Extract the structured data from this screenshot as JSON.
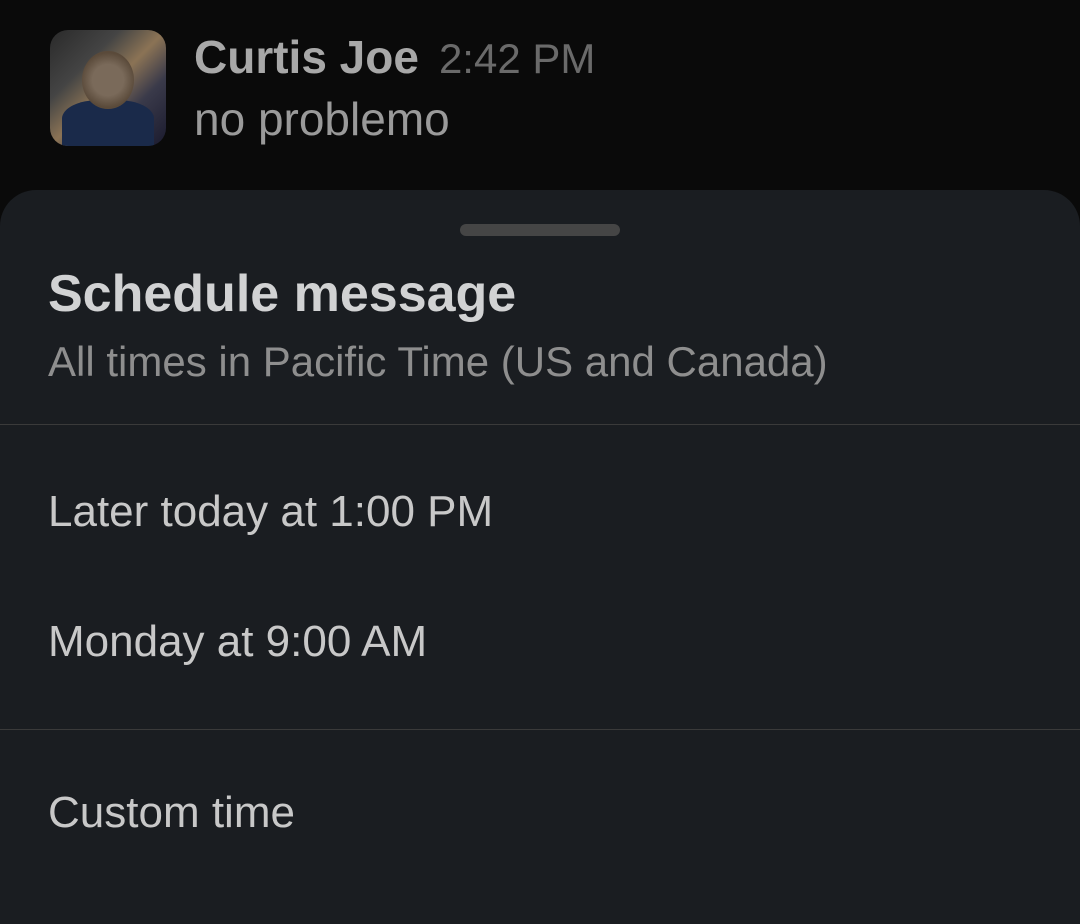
{
  "message": {
    "author": "Curtis Joe",
    "timestamp": "2:42 PM",
    "text": "no problemo"
  },
  "sheet": {
    "title": "Schedule message",
    "subtitle": "All times in Pacific Time (US and Canada)",
    "options": [
      "Later today at 1:00 PM",
      "Monday at 9:00 AM"
    ],
    "custom_option": "Custom time"
  }
}
